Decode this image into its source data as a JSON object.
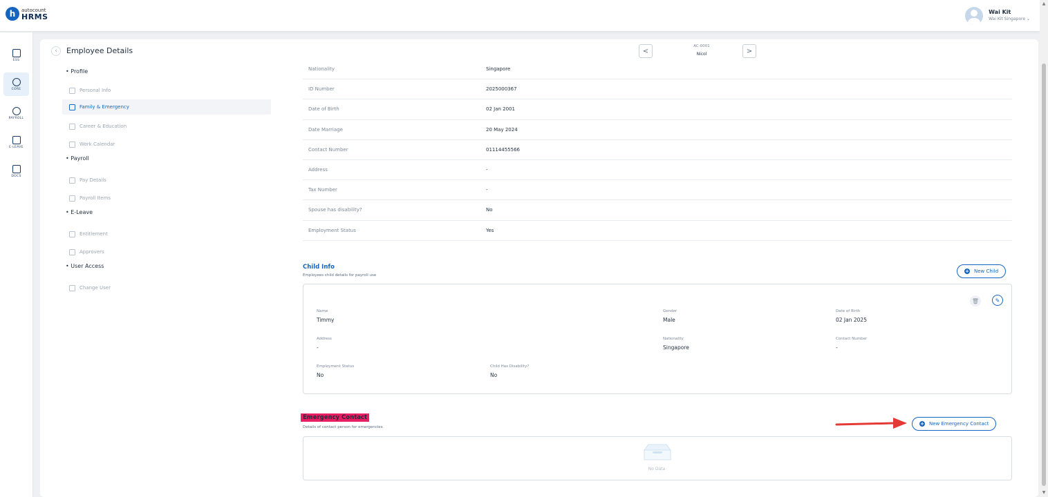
{
  "app": {
    "logo_small": "autocount",
    "logo_big": "HRMS",
    "logo_letter": "h"
  },
  "user": {
    "name": "Wai Kit",
    "subtitle": "Wai Kit Singapore ⌄"
  },
  "rail": [
    {
      "label": "ESS",
      "icon": "ess-icon"
    },
    {
      "label": "CORE",
      "icon": "core-icon",
      "active": true
    },
    {
      "label": "PAYROLL",
      "icon": "payroll-icon"
    },
    {
      "label": "E-LEAVE",
      "icon": "calendar-icon"
    },
    {
      "label": "DOCS",
      "icon": "docs-icon"
    }
  ],
  "header": {
    "title": "Employee Details",
    "employee_code": "AC-0001",
    "employee_name": "Nicol",
    "prev": "<",
    "next": ">"
  },
  "subnav": {
    "profile": "• Profile",
    "personal_info": "Personal Info",
    "family_emergency": "Family & Emergency",
    "career_education": "Career & Education",
    "work_calendar": "Work Calendar",
    "payroll": "• Payroll",
    "pay_details": "Pay Details",
    "payroll_items": "Payroll Items",
    "eleave": "• E-Leave",
    "entitlement": "Entitlement",
    "approvers": "Approvers",
    "user_access": "• User Access",
    "change_user": "Change User"
  },
  "spouse_details": [
    {
      "label": "Nationality",
      "value": "Singapore"
    },
    {
      "label": "ID Number",
      "value": "2025000367"
    },
    {
      "label": "Date of Birth",
      "value": "02 Jan 2001"
    },
    {
      "label": "Date Marriage",
      "value": "20 May 2024"
    },
    {
      "label": "Contact Number",
      "value": "01114455566"
    },
    {
      "label": "Address",
      "value": "-"
    },
    {
      "label": "Tax Number",
      "value": "-"
    },
    {
      "label": "Spouse has disability?",
      "value": "No"
    },
    {
      "label": "Employment Status",
      "value": "Yes"
    }
  ],
  "child_info": {
    "title": "Child Info",
    "subtitle": "Employees child details for payroll use",
    "new_button": "New Child",
    "name_label": "Name",
    "name": "Timmy",
    "gender_label": "Gender",
    "gender": "Male",
    "dob_label": "Date of Birth",
    "dob": "02 Jan 2025",
    "address_label": "Address",
    "address": "-",
    "nationality_label": "Nationality",
    "nationality": "Singapore",
    "contact_label": "Contact Number",
    "contact": "-",
    "employment_label": "Employment Status",
    "employment": "No",
    "disability_label": "Child Has Disability?",
    "disability": "No"
  },
  "emergency": {
    "title": "Emergency Contact",
    "subtitle": "Details of contact person for emergencies",
    "new_button": "New Emergency Contact",
    "empty_text": "No Data"
  },
  "colors": {
    "accent": "#1565c0",
    "highlight": "#e91e63",
    "arrow": "#e53935"
  }
}
